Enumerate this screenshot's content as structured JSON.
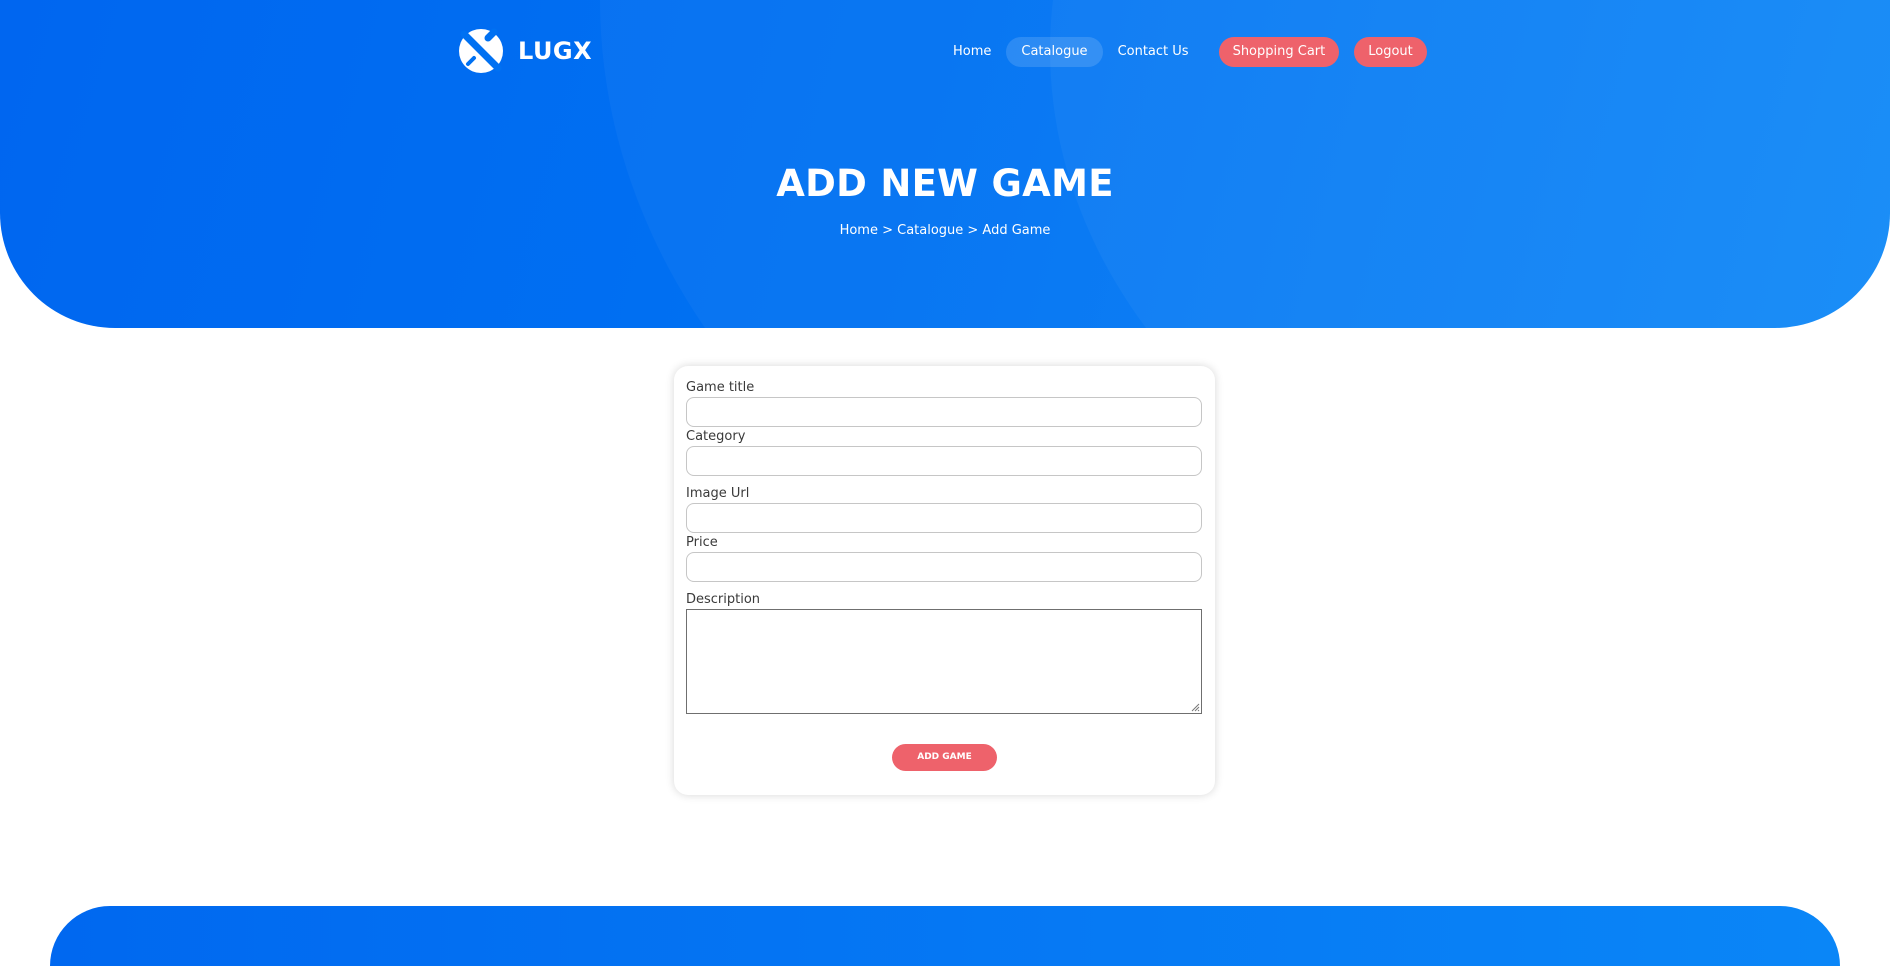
{
  "brand": {
    "name": "LUGX",
    "logo_icon": "x-circle-logo-icon"
  },
  "nav": {
    "items": [
      {
        "label": "Home"
      },
      {
        "label": "Catalogue"
      },
      {
        "label": "Contact Us"
      }
    ],
    "cart_label": "Shopping Cart",
    "logout_label": "Logout"
  },
  "hero": {
    "title": "ADD NEW GAME",
    "breadcrumb": "Home > Catalogue > Add Game"
  },
  "form": {
    "fields": [
      {
        "label": "Game title",
        "value": ""
      },
      {
        "label": "Category",
        "value": ""
      },
      {
        "label": "Image Url",
        "value": ""
      },
      {
        "label": "Price",
        "value": ""
      }
    ],
    "description_label": "Description",
    "description_value": "",
    "submit_label": "ADD GAME"
  },
  "colors": {
    "primary_blue": "#0071f2",
    "accent_red": "#ee626b"
  }
}
